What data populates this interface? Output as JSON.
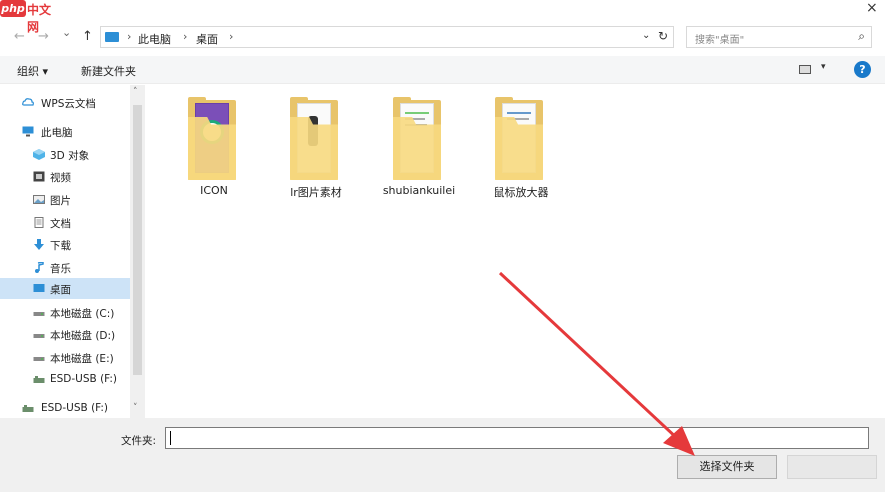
{
  "watermark": {
    "logo_text": "php",
    "site_text": "中文网"
  },
  "window": {
    "close_glyph": "×"
  },
  "nav": {
    "back": "←",
    "forward": "→",
    "recent": "⌄",
    "up": "↑"
  },
  "address": {
    "crumbs": [
      "此电脑",
      "桌面"
    ],
    "sep": "›",
    "dropdown": "⌄",
    "refresh": "↻"
  },
  "search": {
    "placeholder": "搜索\"桌面\"",
    "icon": "⌕"
  },
  "toolbar": {
    "organize": "组织 ▾",
    "new_folder": "新建文件夹",
    "view_dd": "▾",
    "help": "?"
  },
  "sidebar": {
    "items": [
      {
        "label": "WPS云文档",
        "icon": "cloud-icon",
        "level": "top"
      },
      {
        "label": "此电脑",
        "icon": "computer-icon",
        "level": "top"
      },
      {
        "label": "3D 对象",
        "icon": "3d-objects-icon",
        "level": "child"
      },
      {
        "label": "视频",
        "icon": "video-icon",
        "level": "child"
      },
      {
        "label": "图片",
        "icon": "pictures-icon",
        "level": "child"
      },
      {
        "label": "文档",
        "icon": "documents-icon",
        "level": "child"
      },
      {
        "label": "下载",
        "icon": "download-icon",
        "level": "child"
      },
      {
        "label": "音乐",
        "icon": "music-icon",
        "level": "child"
      },
      {
        "label": "桌面",
        "icon": "desktop-icon",
        "level": "child",
        "selected": true
      },
      {
        "label": "本地磁盘 (C:)",
        "icon": "drive-icon",
        "level": "child"
      },
      {
        "label": "本地磁盘 (D:)",
        "icon": "drive-icon",
        "level": "child"
      },
      {
        "label": "本地磁盘 (E:)",
        "icon": "drive-icon",
        "level": "child"
      },
      {
        "label": "ESD-USB (F:)",
        "icon": "usb-drive-icon",
        "level": "child"
      },
      {
        "label": "ESD-USB (F:)",
        "icon": "usb-drive-icon",
        "level": "top"
      }
    ],
    "scroll_up": "˄",
    "scroll_down": "˅"
  },
  "folders": [
    {
      "name": "ICON"
    },
    {
      "name": "lr图片素材"
    },
    {
      "name": "shubiankuilei"
    },
    {
      "name": "鼠标放大器"
    }
  ],
  "footer": {
    "folder_label": "文件夹:",
    "folder_value": "",
    "select_button": "选择文件夹"
  },
  "colors": {
    "accent": "#1979ca",
    "selected_bg": "#cde3f7",
    "folder": "#f7d97f",
    "arrow": "#e5393b"
  }
}
